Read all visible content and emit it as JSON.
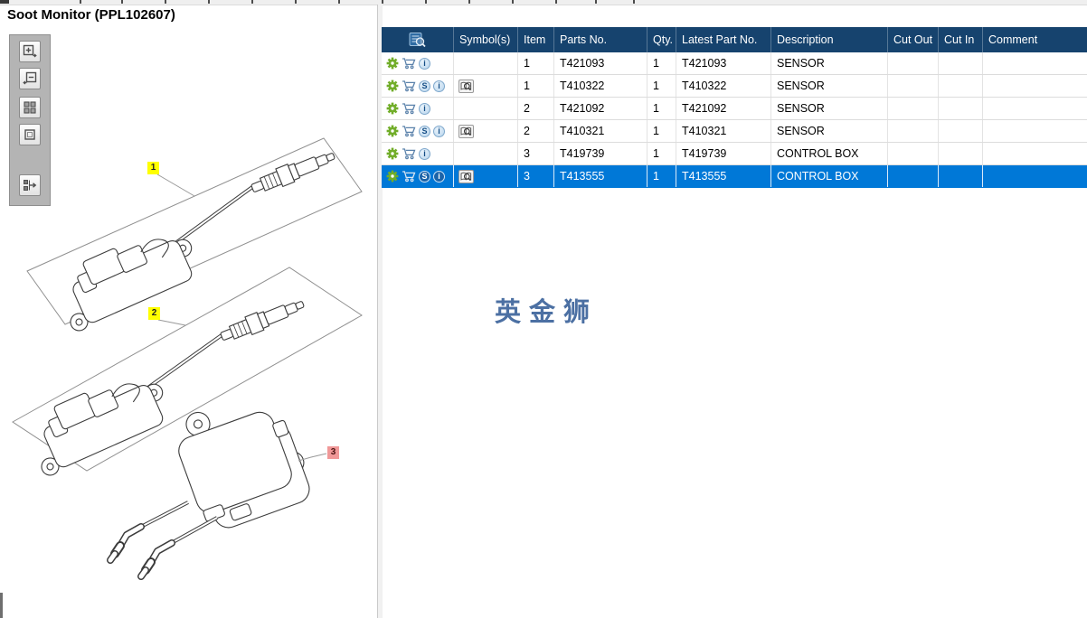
{
  "window": {
    "title": "Soot Monitor (PPL102607)"
  },
  "watermark": {
    "text": "英金狮",
    "color": "#4C70A3"
  },
  "colors": {
    "table_header_bg": "#16436E",
    "selected_row_bg": "#0078D7",
    "callout_highlight_yellow": "#FFFF00",
    "callout_selected_pink": "#F09898",
    "gear_green": "#71AD29",
    "icon_blue": "#5B82AB"
  },
  "toolbar": {
    "buttons": [
      {
        "icon": "zoom-in-icon"
      },
      {
        "icon": "zoom-out-icon"
      },
      {
        "icon": "fit-all-icon"
      },
      {
        "icon": "actual-size-icon"
      },
      {
        "icon": "toggle-panel-icon"
      }
    ]
  },
  "diagram": {
    "callouts": [
      {
        "label": "1",
        "highlight": "yellow"
      },
      {
        "label": "2",
        "highlight": "yellow"
      },
      {
        "label": "3",
        "highlight": "selected-pink"
      }
    ]
  },
  "table": {
    "header_icon": "find-filter-icon",
    "columns": [
      "",
      "Symbol(s)",
      "Item",
      "Parts No.",
      "Qty.",
      "Latest Part No.",
      "Description",
      "Cut Out",
      "Cut In",
      "Comment"
    ],
    "rows": [
      {
        "icons": [
          "gear-icon",
          "cart-icon",
          "info-icon"
        ],
        "symbol": "",
        "item": "1",
        "parts_no": "T421093",
        "qty": "1",
        "latest_part_no": "T421093",
        "description": "SENSOR",
        "cut_out": "",
        "cut_in": "",
        "comment": "",
        "selected": false
      },
      {
        "icons": [
          "gear-icon",
          "cart-icon",
          "s-icon",
          "info-icon"
        ],
        "symbol": "open-book-magnifier-icon",
        "item": "1",
        "parts_no": "T410322",
        "qty": "1",
        "latest_part_no": "T410322",
        "description": "SENSOR",
        "cut_out": "",
        "cut_in": "",
        "comment": "",
        "selected": false
      },
      {
        "icons": [
          "gear-icon",
          "cart-icon",
          "info-icon"
        ],
        "symbol": "",
        "item": "2",
        "parts_no": "T421092",
        "qty": "1",
        "latest_part_no": "T421092",
        "description": "SENSOR",
        "cut_out": "",
        "cut_in": "",
        "comment": "",
        "selected": false
      },
      {
        "icons": [
          "gear-icon",
          "cart-icon",
          "s-icon",
          "info-icon"
        ],
        "symbol": "open-book-magnifier-icon",
        "item": "2",
        "parts_no": "T410321",
        "qty": "1",
        "latest_part_no": "T410321",
        "description": "SENSOR",
        "cut_out": "",
        "cut_in": "",
        "comment": "",
        "selected": false
      },
      {
        "icons": [
          "gear-icon",
          "cart-icon",
          "info-icon"
        ],
        "symbol": "",
        "item": "3",
        "parts_no": "T419739",
        "qty": "1",
        "latest_part_no": "T419739",
        "description": "CONTROL BOX",
        "cut_out": "",
        "cut_in": "",
        "comment": "",
        "selected": false
      },
      {
        "icons": [
          "gear-icon",
          "cart-icon",
          "s-icon",
          "info-icon"
        ],
        "symbol": "open-book-magnifier-icon",
        "item": "3",
        "parts_no": "T413555",
        "qty": "1",
        "latest_part_no": "T413555",
        "description": "CONTROL BOX",
        "cut_out": "",
        "cut_in": "",
        "comment": "",
        "selected": true
      }
    ]
  }
}
